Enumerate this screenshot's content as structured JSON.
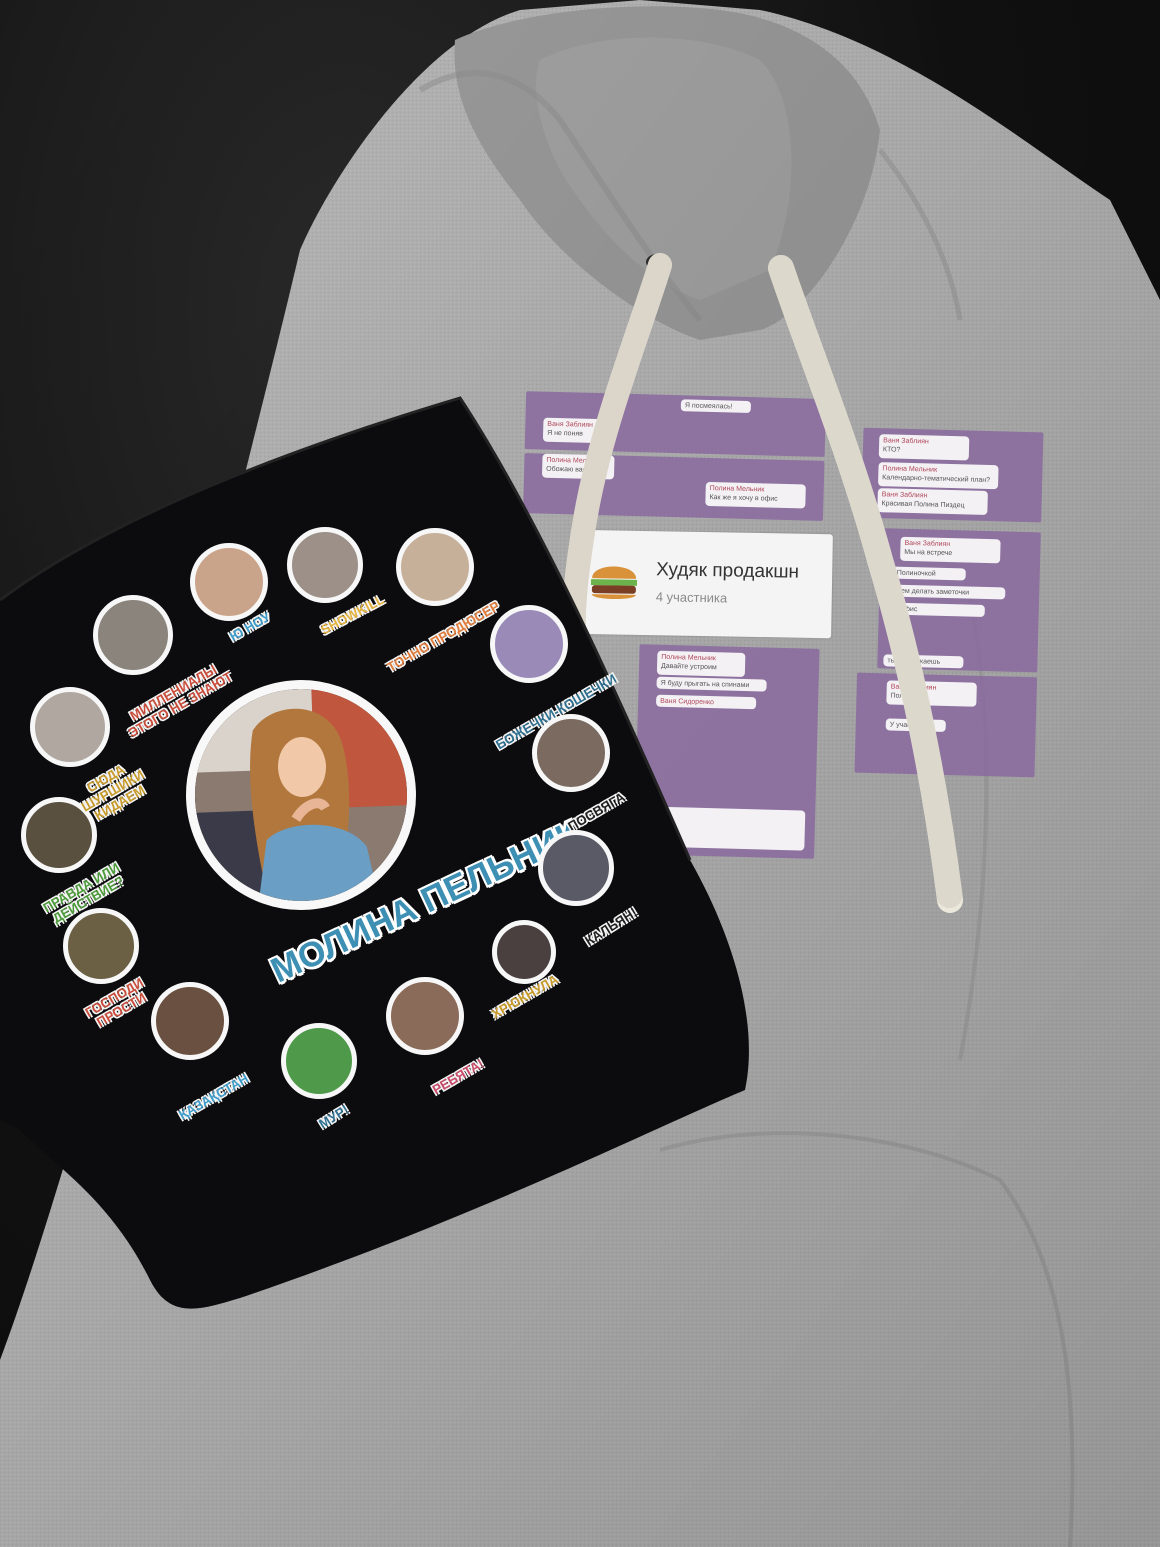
{
  "chat_print": {
    "group_title": "Худяк продакшн",
    "group_subtitle": "4 участника",
    "bubbles": [
      {
        "name": "",
        "text": "Я посмеялась!"
      },
      {
        "name": "Ваня Заблиян",
        "text": "Я не поняв"
      },
      {
        "name": "Полина Мельник",
        "text": "Обожаю вас)"
      },
      {
        "name": "Ваня Заблиян",
        "text": "КТО?"
      },
      {
        "name": "Полина Мельник",
        "text": "Календарно-тематический план?"
      },
      {
        "name": "Ваня Заблиян",
        "text": "Красивая Полина Пиздец"
      },
      {
        "name": "Полина Мельник",
        "text": "Как же я хочу в офис"
      },
      {
        "name": "Ваня Заблиян",
        "text": "Мы на встрече"
      },
      {
        "name": "",
        "text": "С Полиночкой"
      },
      {
        "name": "",
        "text": "Будем делать заметочки"
      },
      {
        "name": "",
        "text": "и в офис"
      },
      {
        "name": "Полина Мельник",
        "text": "Давайте устроим"
      },
      {
        "name": "",
        "text": "Я буду прыгать на спинами"
      },
      {
        "name": "Ваня Сидоренко",
        "text": ""
      },
      {
        "name": "",
        "text": "ты пропускаешь"
      },
      {
        "name": "Ваня Заблиян",
        "text": "Полина М"
      },
      {
        "name": "",
        "text": "У участ"
      }
    ]
  },
  "shirt": {
    "main_name": "МОЛИНА ПЕЛЬНИК",
    "stickers": [
      {
        "caption": "Ю НОУ",
        "color": "#3f9cc9"
      },
      {
        "caption": "SHOWKILL",
        "color": "#e3b23c"
      },
      {
        "caption": "ТОЧНО ПРОДЮСЕР",
        "color": "#e07b39"
      },
      {
        "caption": "БОЖЕЧКИ-КОШЕЧКИ",
        "color": "#2f6f8f"
      },
      {
        "caption": "ПОСВЯГА",
        "color": "#1f1f1f"
      },
      {
        "caption": "КАЛЬЯН!",
        "color": "#1f1f1f"
      },
      {
        "caption": "ХРЮКНУЛА",
        "color": "#c79a2a"
      },
      {
        "caption": "РЕБЯТА!",
        "color": "#c94c6a"
      },
      {
        "caption": "МУР!",
        "color": "#2f6f8f"
      },
      {
        "caption": "ҚАЗАҚСТАН",
        "color": "#3f9cc9"
      },
      {
        "caption": "ГОСПОДИ ПРОСТИ",
        "color": "#c94c3a"
      },
      {
        "caption": "ПРАВДА ИЛИ ДЕЙСТВИЕ?",
        "color": "#4c9a3a"
      },
      {
        "caption": "СЮДА ШУРШИКИ КИДАЕМ",
        "color": "#c79a2a"
      },
      {
        "caption": "МИЛЛЕНИАЛЫ ЭТОГО НЕ ЗНАЮТ",
        "color": "#c94c3a"
      }
    ]
  },
  "colors": {
    "hoodie": "#b5b5b5",
    "shirt": "#0c0c0e",
    "chat_purple": "#8a6aa0",
    "title_blue": "#3e8fb4"
  }
}
